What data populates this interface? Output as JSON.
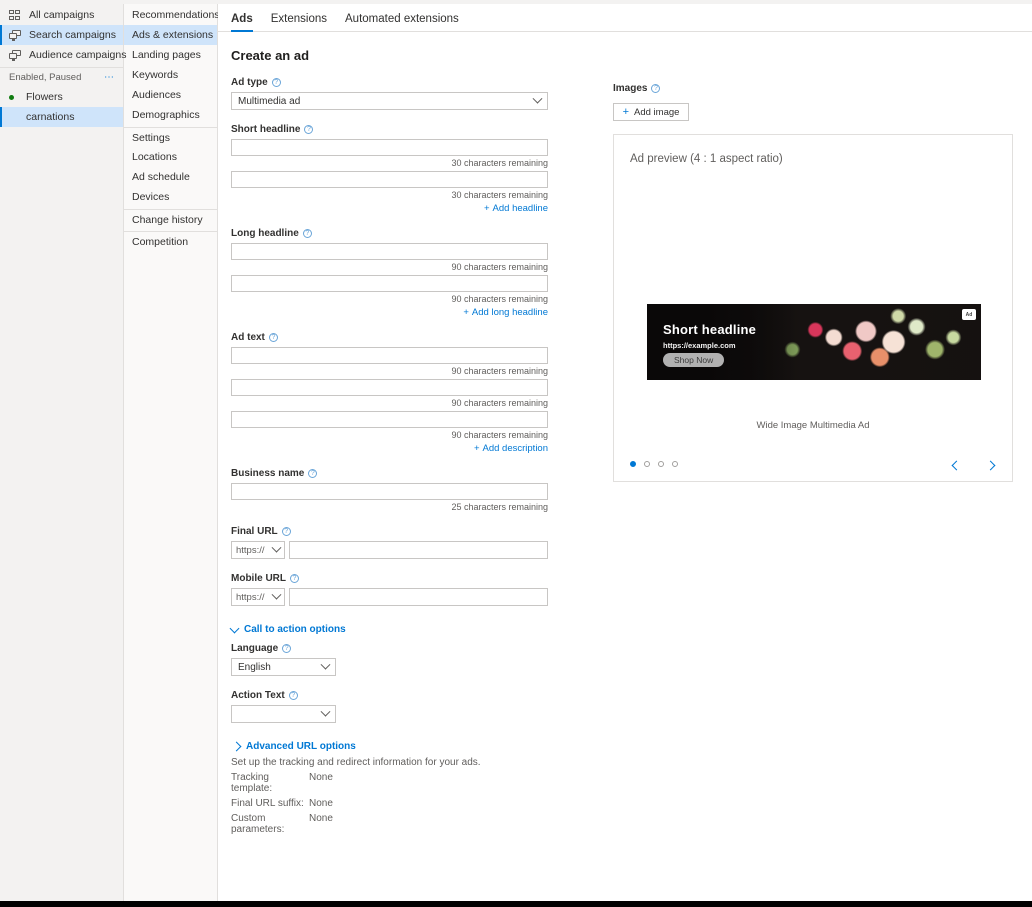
{
  "nav_primary": {
    "items": [
      {
        "label": "All campaigns",
        "icon": "grid-icon",
        "selected": false
      },
      {
        "label": "Search campaigns",
        "icon": "monitor-icon",
        "selected": true
      },
      {
        "label": "Audience campaigns",
        "icon": "monitor-icon",
        "selected": false
      }
    ],
    "section_label": "Enabled, Paused",
    "overflow_icon": "ellipsis-icon",
    "campaigns": [
      {
        "label": "Flowers",
        "status_color": "#107c10",
        "child": false,
        "selected": false
      },
      {
        "label": "carnations",
        "child": true,
        "selected": true
      }
    ]
  },
  "nav_secondary": {
    "items": [
      {
        "label": "Recommendations",
        "selected": false,
        "separator_before": false
      },
      {
        "label": "Ads & extensions",
        "selected": true,
        "separator_before": false
      },
      {
        "label": "Landing pages",
        "selected": false,
        "separator_before": false
      },
      {
        "label": "Keywords",
        "selected": false,
        "separator_before": false
      },
      {
        "label": "Audiences",
        "selected": false,
        "separator_before": false
      },
      {
        "label": "Demographics",
        "selected": false,
        "separator_before": false
      },
      {
        "label": "Settings",
        "selected": false,
        "separator_before": true
      },
      {
        "label": "Locations",
        "selected": false,
        "separator_before": false
      },
      {
        "label": "Ad schedule",
        "selected": false,
        "separator_before": false
      },
      {
        "label": "Devices",
        "selected": false,
        "separator_before": false
      },
      {
        "label": "Change history",
        "selected": false,
        "separator_before": true
      },
      {
        "label": "Competition",
        "selected": false,
        "separator_before": true
      }
    ]
  },
  "tabs": [
    {
      "label": "Ads",
      "active": true
    },
    {
      "label": "Extensions",
      "active": false
    },
    {
      "label": "Automated extensions",
      "active": false
    }
  ],
  "page": {
    "title": "Create an ad"
  },
  "form": {
    "ad_type": {
      "label": "Ad type",
      "value": "Multimedia ad"
    },
    "short_headline": {
      "label": "Short headline",
      "fields": [
        {
          "value": "",
          "counter": "30 characters remaining"
        },
        {
          "value": "",
          "counter": "30 characters remaining"
        }
      ],
      "add_label": "Add headline"
    },
    "long_headline": {
      "label": "Long headline",
      "fields": [
        {
          "value": "",
          "counter": "90 characters remaining"
        },
        {
          "value": "",
          "counter": "90 characters remaining"
        }
      ],
      "add_label": "Add long headline"
    },
    "ad_text": {
      "label": "Ad text",
      "fields": [
        {
          "value": "",
          "counter": "90 characters remaining"
        },
        {
          "value": "",
          "counter": "90 characters remaining"
        },
        {
          "value": "",
          "counter": "90 characters remaining"
        }
      ],
      "add_label": "Add description"
    },
    "business_name": {
      "label": "Business name",
      "value": "",
      "counter": "25 characters remaining"
    },
    "final_url": {
      "label": "Final URL",
      "protocol": "https://",
      "value": ""
    },
    "mobile_url": {
      "label": "Mobile URL",
      "protocol": "https://",
      "value": ""
    },
    "call_to_action": {
      "label": "Call to action options",
      "expanded": true,
      "language": {
        "label": "Language",
        "value": "English"
      },
      "action_text": {
        "label": "Action Text",
        "value": ""
      }
    },
    "advanced_url": {
      "label": "Advanced URL options",
      "expanded": false,
      "description": "Set up the tracking and redirect information for your ads.",
      "rows": [
        {
          "key": "Tracking template:",
          "value": "None"
        },
        {
          "key": "Final URL suffix:",
          "value": "None"
        },
        {
          "key": "Custom parameters:",
          "value": "None"
        }
      ]
    }
  },
  "images_panel": {
    "label": "Images",
    "add_button": "Add image",
    "preview_title": "Ad preview (4 : 1 aspect ratio)",
    "banner": {
      "headline": "Short headline",
      "url": "https://example.com",
      "cta": "Shop Now",
      "badge": "Ad"
    },
    "caption": "Wide Image Multimedia Ad",
    "carousel": {
      "total": 4,
      "active_index": 0
    },
    "prev_icon": "chevron-left-icon",
    "next_icon": "chevron-right-icon"
  },
  "colors": {
    "accent": "#0078d4",
    "selection": "#cfe4fa",
    "status_green": "#107c10"
  }
}
